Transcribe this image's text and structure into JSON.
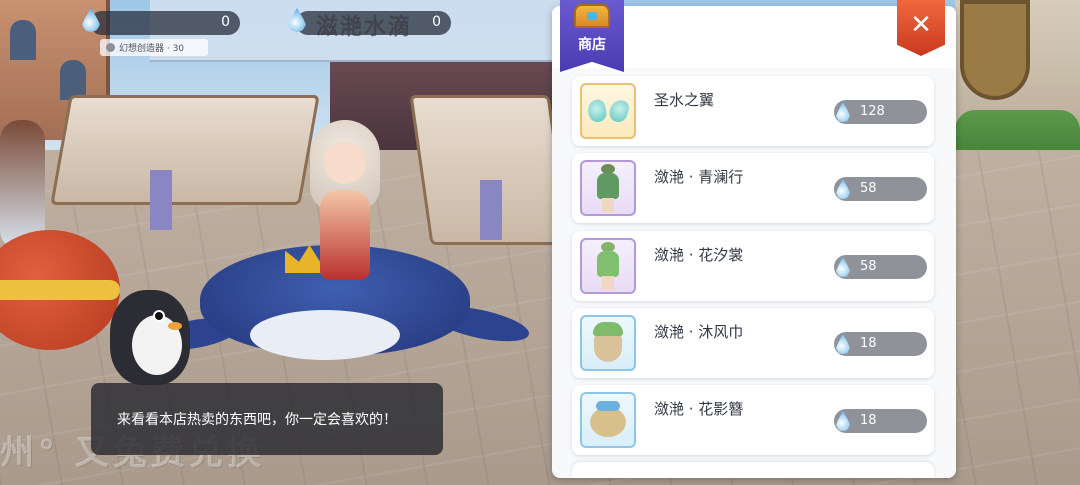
{
  "hud": {
    "currency_left": {
      "icon": "water-drop-icon",
      "value": "0"
    },
    "currency_right": {
      "icon": "water-drop-icon",
      "label": "滋滟水滴",
      "value": "0"
    },
    "creator_tag": "幻想创造器 · 30"
  },
  "watermark": "州° 又兔费兑换",
  "dialog": {
    "text": "来看看本店热卖的东西吧，你一定会喜欢的！"
  },
  "shop": {
    "badge_label": "商店",
    "badge_icon": "treasure-chest-icon",
    "close_icon": "close-icon",
    "price_icon": "water-drop-icon",
    "items": [
      {
        "name": "圣水之翼",
        "price": "128",
        "thumb": "wing-icon",
        "frame": "gold"
      },
      {
        "name": "潋滟 · 青澜行",
        "price": "58",
        "thumb": "outfit-icon",
        "frame": "purple"
      },
      {
        "name": "潋滟 · 花汐裳",
        "price": "58",
        "thumb": "outfit-icon",
        "frame": "purple"
      },
      {
        "name": "潋滟 · 沐风巾",
        "price": "18",
        "thumb": "headscarf-icon",
        "frame": "blue"
      },
      {
        "name": "潋滟 · 花影簪",
        "price": "18",
        "thumb": "hairpin-icon",
        "frame": "blue"
      }
    ]
  },
  "colors": {
    "shop_badge": "#5a48c0",
    "close_button": "#e0512e",
    "price_pill": "#8f9298"
  }
}
